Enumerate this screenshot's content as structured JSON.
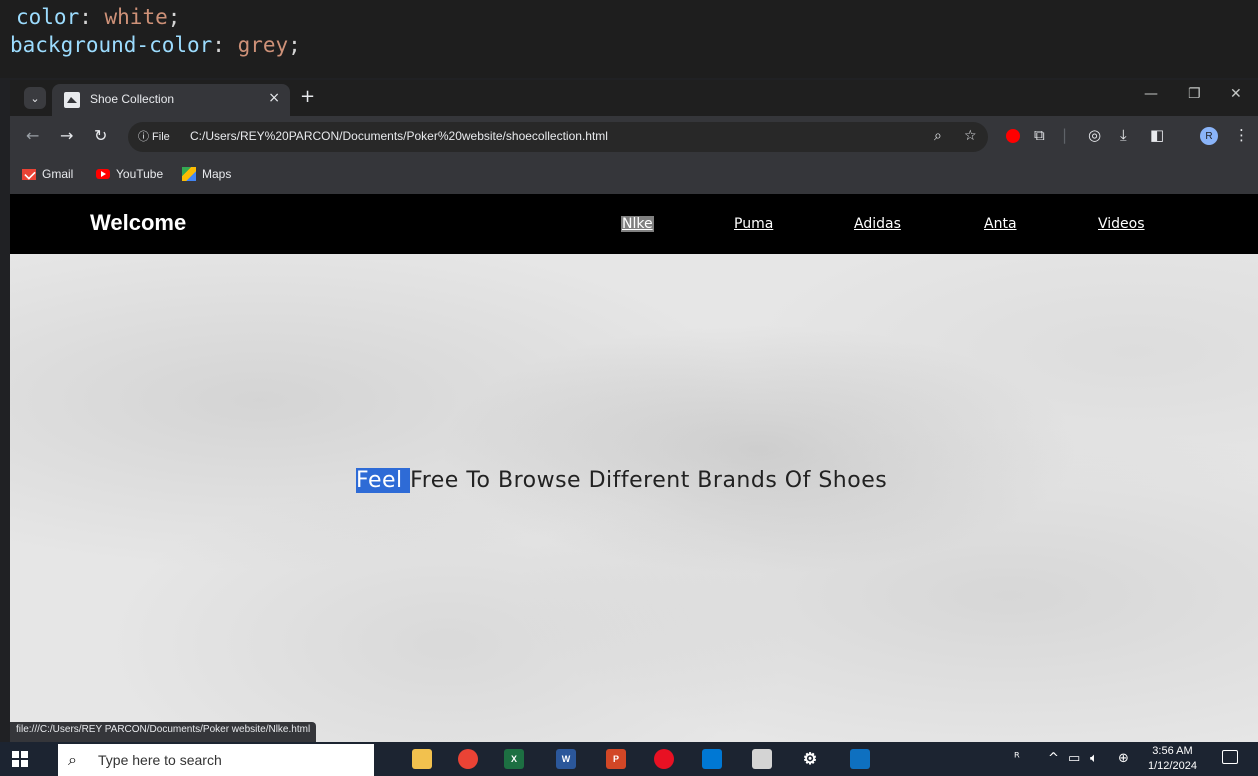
{
  "code_editor": {
    "line1": {
      "property": "color",
      "value": "white"
    },
    "line2": {
      "property": "background-color",
      "value": "grey"
    }
  },
  "browser": {
    "tab_title": "Shoe Collection",
    "new_tab_symbol": "+",
    "close_symbol": "×",
    "file_chip": "ⓘ File",
    "url": "C:/Users/REY%20PARCON/Documents/Poker%20website/shoecollection.html",
    "avatar_letter": "R",
    "bookmarks": [
      {
        "label": "Gmail"
      },
      {
        "label": "YouTube"
      },
      {
        "label": "Maps"
      }
    ],
    "status_url": "file:///C:/Users/REY PARCON/Documents/Poker website/Nlke.html"
  },
  "site": {
    "title": "Welcome",
    "nav": [
      {
        "label": "Nlke"
      },
      {
        "label": "Puma "
      },
      {
        "label": "Adidas "
      },
      {
        "label": "Anta "
      },
      {
        "label": "Videos"
      }
    ],
    "hero_selected": "Feel ",
    "hero_rest": "Free To Browse Different Brands Of Shoes"
  },
  "taskbar": {
    "search_placeholder": "Type here to search",
    "time": "3:56 AM",
    "date": "1/12/2024",
    "apps": [
      {
        "label": "",
        "color": "#f2c14e"
      },
      {
        "label": "",
        "color": "#ea4335"
      },
      {
        "label": "X",
        "color": "#1d6f42"
      },
      {
        "label": "W",
        "color": "#2b579a"
      },
      {
        "label": "P",
        "color": "#d24726"
      },
      {
        "label": "",
        "color": "#e81123"
      },
      {
        "label": "",
        "color": "#0078d4"
      },
      {
        "label": "",
        "color": "#d4d4d4"
      },
      {
        "label": "",
        "color": "#1c2431"
      },
      {
        "label": "",
        "color": "#0e70c0"
      }
    ]
  }
}
